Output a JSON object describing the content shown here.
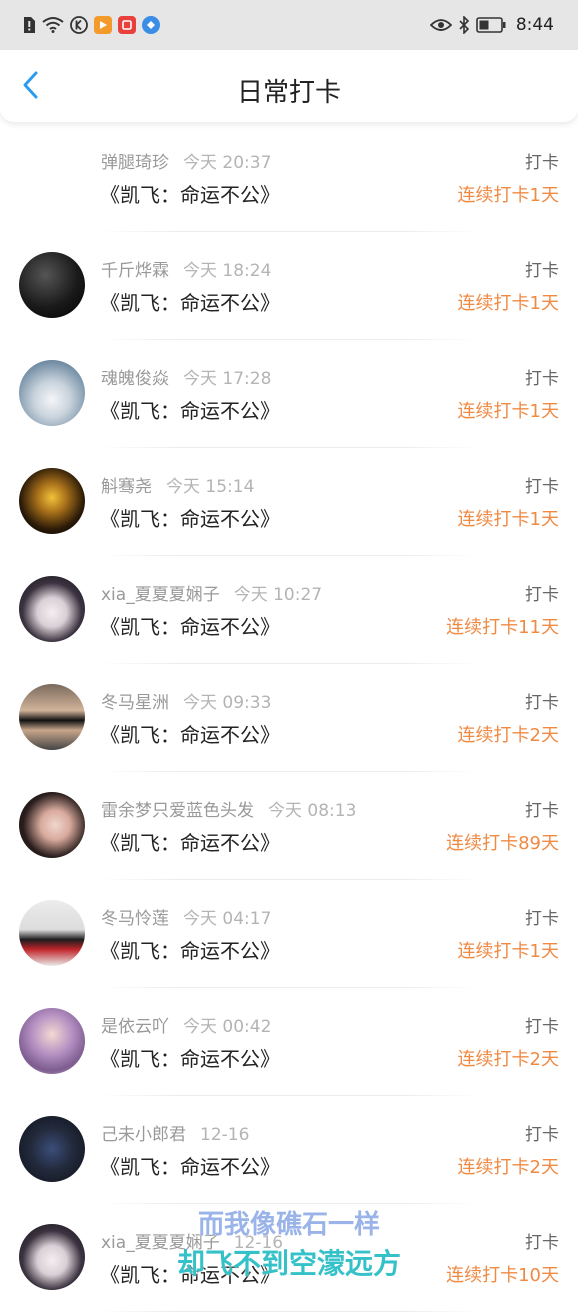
{
  "status_bar": {
    "time": "8:44",
    "left_icons": [
      "alert-icon",
      "wifi-icon",
      "k-app-icon",
      "video-app-icon",
      "red-app-icon",
      "blue-app-icon"
    ],
    "right_icons": [
      "eye-icon",
      "bluetooth-icon",
      "battery-icon"
    ]
  },
  "header": {
    "title": "日常打卡",
    "back_icon": "chevron-left-icon",
    "accent": "#2d9bf0"
  },
  "colors": {
    "streak": "#f08a43",
    "name": "#999999",
    "time": "#b4b4b4",
    "lyric1": "#9ab4ea",
    "lyric2": "#35c1c8"
  },
  "entries": [
    {
      "name": "弹腿琦珍",
      "time": "今天 20:37",
      "book": "《凯飞：命运不公》",
      "action": "打卡",
      "streak": "连续打卡1天",
      "avatar": "none"
    },
    {
      "name": "千斤烨霖",
      "time": "今天 18:24",
      "book": "《凯飞：命运不公》",
      "action": "打卡",
      "streak": "连续打卡1天",
      "avatar": "dark-text"
    },
    {
      "name": "魂魄俊焱",
      "time": "今天 17:28",
      "book": "《凯飞：命运不公》",
      "action": "打卡",
      "streak": "连续打卡1天",
      "avatar": "snow-tree"
    },
    {
      "name": "斛骞尧",
      "time": "今天 15:14",
      "book": "《凯飞：命运不公》",
      "action": "打卡",
      "streak": "连续打卡1天",
      "avatar": "gold-robot"
    },
    {
      "name": "xia_夏夏夏娴子",
      "time": "今天 10:27",
      "book": "《凯飞：命运不公》",
      "action": "打卡",
      "streak": "连续打卡11天",
      "avatar": "anime-girl"
    },
    {
      "name": "冬马星洲",
      "time": "今天 09:33",
      "book": "《凯飞：命运不公》",
      "action": "打卡",
      "streak": "连续打卡2天",
      "avatar": "sunglasses-man"
    },
    {
      "name": "雷余梦只爱蓝色头发",
      "time": "今天 08:13",
      "book": "《凯飞：命运不公》",
      "action": "打卡",
      "streak": "连续打卡89天",
      "avatar": "girl-portrait"
    },
    {
      "name": "冬马怜莲",
      "time": "今天 04:17",
      "book": "《凯飞：命运不公》",
      "action": "打卡",
      "streak": "连续打卡1天",
      "avatar": "woman-banner"
    },
    {
      "name": "是依云吖",
      "time": "今天 00:42",
      "book": "《凯飞：命运不公》",
      "action": "打卡",
      "streak": "连续打卡2天",
      "avatar": "purple-hair"
    },
    {
      "name": "己未小郎君",
      "time": "12-16",
      "book": "《凯飞：命运不公》",
      "action": "打卡",
      "streak": "连续打卡2天",
      "avatar": "night-car"
    },
    {
      "name": "xia_夏夏夏娴子",
      "time": "12-16",
      "book": "《凯飞：命运不公》",
      "action": "打卡",
      "streak": "连续打卡10天",
      "avatar": "anime-girl"
    }
  ],
  "lyrics": {
    "line1": "而我像礁石一样",
    "line2": "却飞不到空濛远方"
  }
}
